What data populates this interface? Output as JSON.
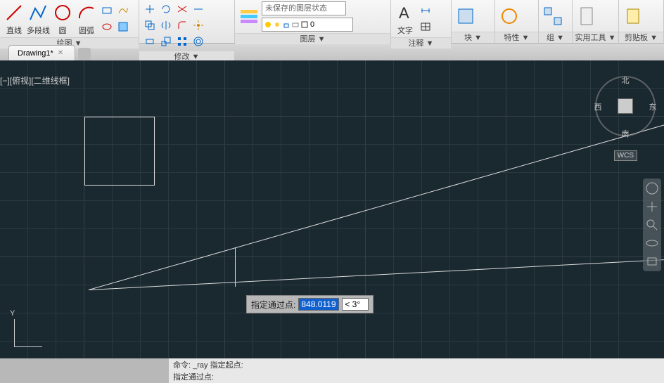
{
  "ribbon": {
    "draw": {
      "title": "绘图 ▼",
      "line": "直线",
      "polyline": "多段线",
      "circle": "圆",
      "arc": "圆弧"
    },
    "modify": {
      "title": "修改 ▼"
    },
    "layer": {
      "title": "图层 ▼",
      "state": "未保存的图层状态",
      "current": "0"
    },
    "annotation": {
      "title": "注释 ▼",
      "text": "文字"
    },
    "block": {
      "title": "块 ▼"
    },
    "properties": {
      "title": "特性 ▼"
    },
    "group": {
      "title": "组 ▼"
    },
    "utilities": {
      "title": "实用工具 ▼"
    },
    "clipboard": {
      "title": "剪贴板 ▼"
    }
  },
  "tabs": {
    "active": "Drawing1*"
  },
  "viewport": {
    "label": "[−][俯视][二维线框]"
  },
  "compass": {
    "n": "北",
    "s": "南",
    "e": "东",
    "w": "西",
    "wcs": "WCS"
  },
  "prompt": {
    "label": "指定通过点:",
    "value": "848.0119",
    "angle": "< 3°"
  },
  "command": {
    "line1": "命令: _ray 指定起点:",
    "line2": "指定通过点:"
  }
}
